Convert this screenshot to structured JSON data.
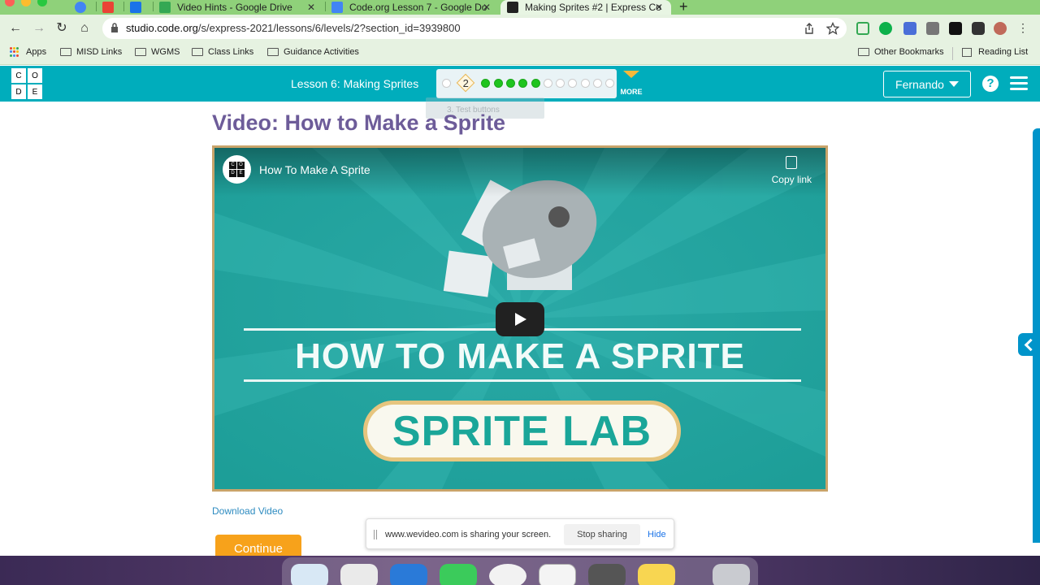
{
  "browser": {
    "tabs": [
      {
        "label": ""
      },
      {
        "label": ""
      },
      {
        "label": ""
      },
      {
        "label": "Video Hints - Google Drive"
      },
      {
        "label": "Code.org Lesson 7 - Google Do"
      },
      {
        "label": "Making Sprites #2 | Express Co"
      }
    ],
    "url_domain": "studio.code.org",
    "url_path": "/s/express-2021/lessons/6/levels/2?section_id=3939800",
    "bookmarks": [
      "Apps",
      "MISD Links",
      "WGMS",
      "Class Links",
      "Guidance Activities"
    ],
    "bookmarks_right": [
      "Other Bookmarks",
      "Reading List"
    ]
  },
  "header": {
    "logo_letters": [
      "C",
      "O",
      "D",
      "E"
    ],
    "lesson_title": "Lesson 6: Making Sprites",
    "current_level": "2",
    "progress": [
      "empty",
      "current",
      "done",
      "done",
      "done",
      "done",
      "done",
      "empty",
      "empty",
      "empty",
      "empty",
      "empty",
      "empty"
    ],
    "more_label": "MORE",
    "user_name": "Fernando",
    "help_label": "?"
  },
  "tooltip_ghost": "3. Test buttons",
  "main": {
    "title": "Video: How to Make a Sprite",
    "video": {
      "title": "How To Make A Sprite",
      "copy_link": "Copy link",
      "headline": "HOW TO MAKE A SPRITE",
      "badge": "SPRITE LAB"
    },
    "download_label": "Download Video",
    "continue_label": "Continue"
  },
  "share_bar": {
    "message": "www.wevideo.com is sharing your screen.",
    "stop_label": "Stop sharing",
    "hide_label": "Hide"
  },
  "colors": {
    "tabstrip": "#8fd17a",
    "header": "#00adbc",
    "title": "#6d5c99",
    "continue": "#f7a21b",
    "progress_done": "#1ec41e"
  }
}
